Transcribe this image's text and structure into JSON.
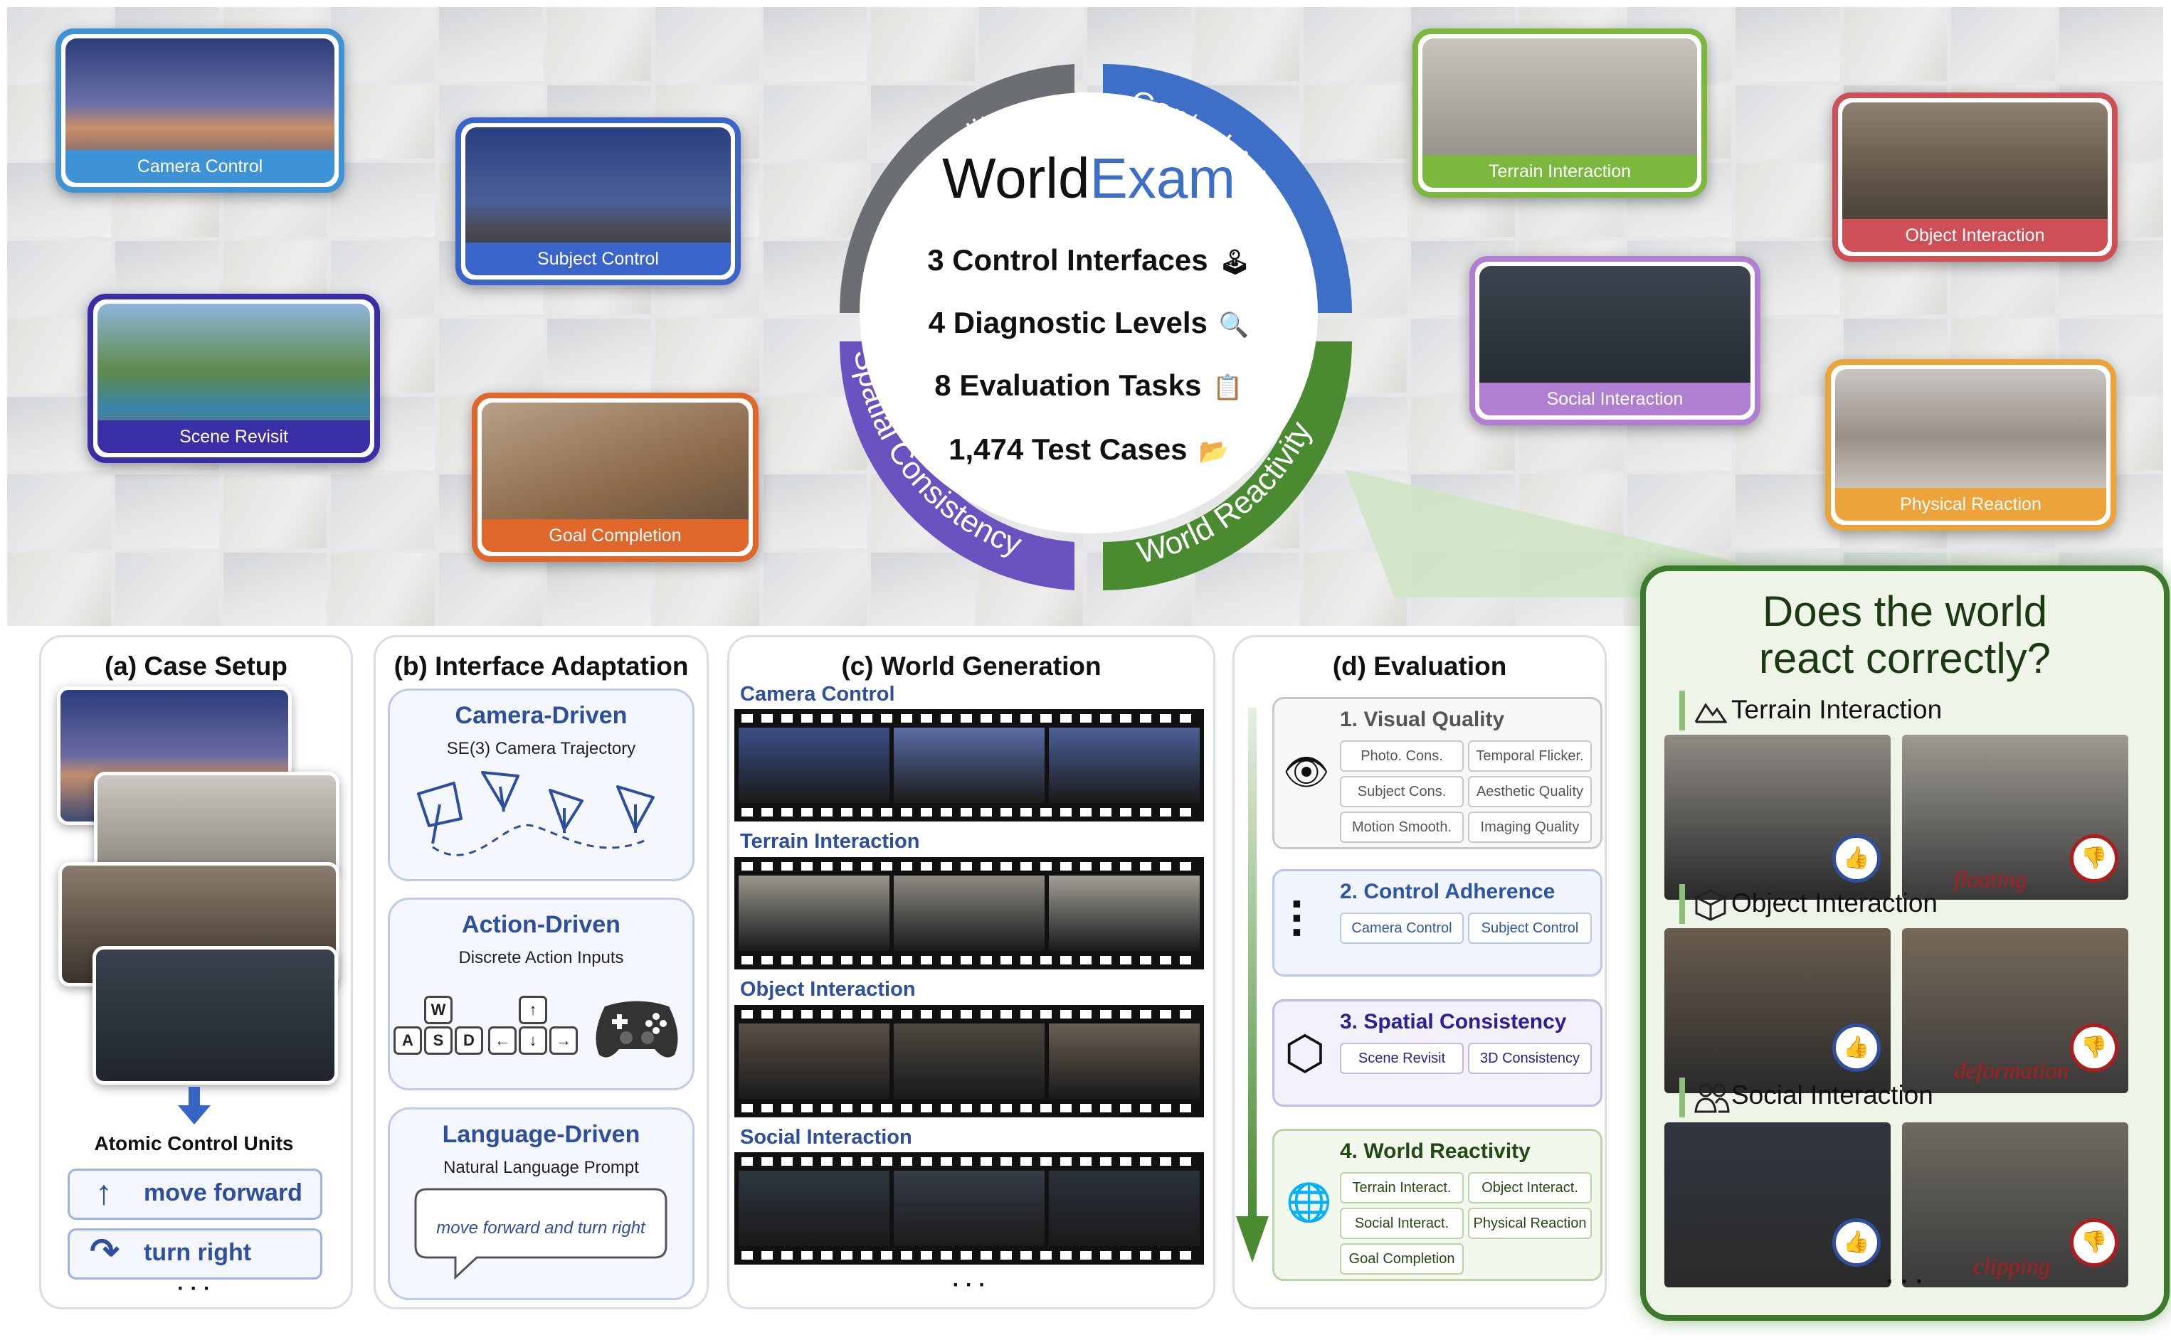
{
  "top": {
    "cards": [
      {
        "id": "camera-control",
        "label": "Camera Control",
        "color": "#3d93d6"
      },
      {
        "id": "subject-control",
        "label": "Subject Control",
        "color": "#3a64c9"
      },
      {
        "id": "scene-revisit",
        "label": "Scene Revisit",
        "color": "#3a2ea6"
      },
      {
        "id": "goal-completion",
        "label": "Goal Completion",
        "color": "#e0672a"
      },
      {
        "id": "terrain-interaction",
        "label": "Terrain Interaction",
        "color": "#7bb83e"
      },
      {
        "id": "object-interaction",
        "label": "Object Interaction",
        "color": "#cf4f57"
      },
      {
        "id": "social-interaction",
        "label": "Social Interaction",
        "color": "#b07fd1"
      },
      {
        "id": "physical-reaction",
        "label": "Physical Reaction",
        "color": "#eba33a"
      }
    ],
    "ring": {
      "segments": [
        {
          "label": "Visual Quality",
          "color": "#6b6e72"
        },
        {
          "label": "Control Adherence",
          "color": "#3d6fc7"
        },
        {
          "label": "World Reactivity",
          "color": "#4a8b32"
        },
        {
          "label": "Spatial Consistency",
          "color": "#6a52c0"
        }
      ],
      "title_part1": "World",
      "title_part2": "Exam",
      "title_color1": "#111111",
      "title_color2": "#3d6fc7",
      "lines": [
        {
          "text": "3 Control Interfaces",
          "icon": "joystick-icon",
          "glyph": "🕹"
        },
        {
          "text": "4 Diagnostic Levels",
          "icon": "magnifier-icon",
          "glyph": "🔍"
        },
        {
          "text": "8 Evaluation Tasks",
          "icon": "clipboard-icon",
          "glyph": "📋"
        },
        {
          "text": "1,474 Test Cases",
          "icon": "folder-icon",
          "glyph": "📂"
        }
      ]
    }
  },
  "panel_a": {
    "title": "(a) Case Setup",
    "atomic_title": "Atomic Control Units",
    "units": [
      {
        "label": "move forward",
        "icon": "arrow-up-icon",
        "glyph": "↑"
      },
      {
        "label": "turn right",
        "icon": "turn-right-icon",
        "glyph": "↷"
      }
    ],
    "ellipsis": "· · ·"
  },
  "panel_b": {
    "title": "(b) Interface Adaptation",
    "camera": {
      "heading": "Camera-Driven",
      "sub": "SE(3) Camera Trajectory"
    },
    "action": {
      "heading": "Action-Driven",
      "sub": "Discrete Action Inputs",
      "keys": [
        "W",
        "A",
        "S",
        "D",
        "↑",
        "←",
        "↓",
        "→"
      ]
    },
    "language": {
      "heading": "Language-Driven",
      "sub": "Natural Language Prompt",
      "prompt": "move forward and turn right"
    }
  },
  "panel_c": {
    "title": "(c) World Generation",
    "strips": [
      {
        "label": "Camera Control",
        "tones": [
          "#3a4f86",
          "#5a6ea6",
          "#4a5f96"
        ]
      },
      {
        "label": "Terrain Interaction",
        "tones": [
          "#9b978f",
          "#8d8982",
          "#a39f97"
        ]
      },
      {
        "label": "Object Interaction",
        "tones": [
          "#5b5046",
          "#4d4840",
          "#6a5f52"
        ]
      },
      {
        "label": "Social Interaction",
        "tones": [
          "#2e3540",
          "#343b46",
          "#2a313c"
        ]
      }
    ],
    "ellipsis": "· · ·"
  },
  "panel_d": {
    "title": "(d) Evaluation",
    "levels": [
      {
        "heading": "1. Visual Quality",
        "icon": "eye-icon",
        "glyph": "👁",
        "border": "#c9c9c9",
        "bg": "#f7f7f7",
        "hcolor": "#555555",
        "chips": [
          "Photo. Cons.",
          "Temporal Flicker.",
          "Subject Cons.",
          "Aesthetic Quality",
          "Motion Smooth.",
          "Imaging Quality"
        ]
      },
      {
        "heading": "2. Control Adherence",
        "icon": "sliders-icon",
        "glyph": "⫶",
        "border": "#b7c8ea",
        "bg": "#f1f5fd",
        "hcolor": "#2d55a8",
        "chips": [
          "Camera Control",
          "Subject Control"
        ]
      },
      {
        "heading": "3. Spatial Consistency",
        "icon": "cube-icon",
        "glyph": "⬡",
        "border": "#c2b8ea",
        "bg": "#f4f1fd",
        "hcolor": "#2a1f93",
        "chips": [
          "Scene Revisit",
          "3D Consistency"
        ]
      },
      {
        "heading": "4. World Reactivity",
        "icon": "globe-icon",
        "glyph": "🌐",
        "border": "#b9d5a8",
        "bg": "#f2f8ee",
        "hcolor": "#234a14",
        "chips": [
          "Terrain Interact.",
          "Object Interact.",
          "Social Interact.",
          "Physical Reaction",
          "Goal Completion"
        ]
      }
    ]
  },
  "callout": {
    "question_line1": "Does the world",
    "question_line2": "react correctly?",
    "tasks": [
      {
        "label": "Terrain Interaction",
        "icon": "mountain-icon",
        "failure": "floating",
        "tones": [
          "#8e8a84",
          "#9d9992"
        ]
      },
      {
        "label": "Object Interaction",
        "icon": "box-icon",
        "failure": "deformation",
        "tones": [
          "#6a5c4e",
          "#77695a"
        ]
      },
      {
        "label": "Social Interaction",
        "icon": "people-icon",
        "failure": "clipping",
        "tones": [
          "#30363f",
          "#6e6a62"
        ]
      }
    ],
    "ellipsis": "· · ·",
    "good_color": "#2d4f9e",
    "bad_color": "#b01c1c"
  }
}
